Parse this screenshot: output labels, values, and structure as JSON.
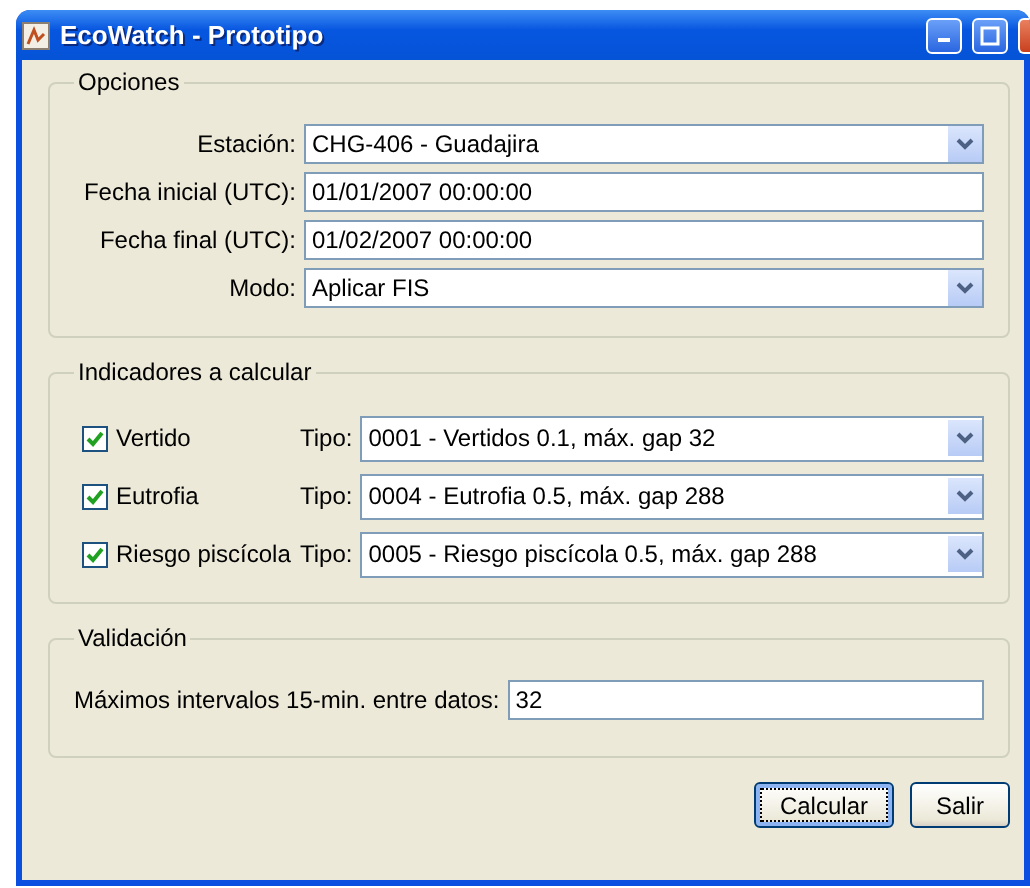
{
  "window": {
    "title": "EcoWatch - Prototipo"
  },
  "opciones": {
    "legend": "Opciones",
    "rows": [
      {
        "kind": "combo",
        "label": "Estación:",
        "value": "CHG-406 - Guadajira"
      },
      {
        "kind": "text",
        "label": "Fecha inicial (UTC):",
        "value": "01/01/2007 00:00:00"
      },
      {
        "kind": "text",
        "label": "Fecha final (UTC):",
        "value": "01/02/2007 00:00:00"
      },
      {
        "kind": "combo",
        "label": "Modo:",
        "value": "Aplicar FIS"
      }
    ]
  },
  "indicadores": {
    "legend": "Indicadores a calcular",
    "items": [
      {
        "label": "Vertido",
        "checked": true,
        "tipo_label": "Tipo:",
        "tipo": "0001 - Vertidos 0.1, máx. gap 32"
      },
      {
        "label": "Eutrofia",
        "checked": true,
        "tipo_label": "Tipo:",
        "tipo": "0004 - Eutrofia 0.5, máx. gap 288"
      },
      {
        "label": "Riesgo piscícola",
        "checked": true,
        "tipo_label": "Tipo:",
        "tipo": "0005 - Riesgo piscícola 0.5, máx. gap 288"
      }
    ]
  },
  "validacion": {
    "legend": "Validación",
    "label": "Máximos intervalos 15-min. entre datos:",
    "value": "32"
  },
  "buttons": [
    {
      "label": "Calcular",
      "focused": true
    },
    {
      "label": "Salir",
      "focused": false
    }
  ]
}
